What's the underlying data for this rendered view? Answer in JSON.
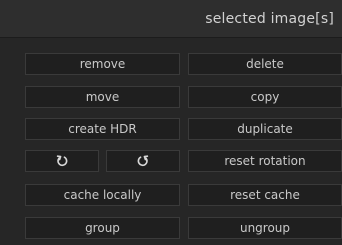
{
  "header": {
    "title": "selected image[s]"
  },
  "buttons": {
    "remove": "remove",
    "delete": "delete",
    "move": "move",
    "copy": "copy",
    "create_hdr": "create HDR",
    "duplicate": "duplicate",
    "rotate_ccw_icon": "rotate-counterclockwise-icon",
    "rotate_cw_icon": "rotate-clockwise-icon",
    "reset_rotation": "reset rotation",
    "cache_locally": "cache locally",
    "reset_cache": "reset cache",
    "group": "group",
    "ungroup": "ungroup"
  },
  "colors": {
    "panel_bg": "#262626",
    "header_bg": "#2e2e2e",
    "button_bg": "#1f1f1f",
    "button_border": "#3a3a3a",
    "text": "#c9c9c9"
  }
}
